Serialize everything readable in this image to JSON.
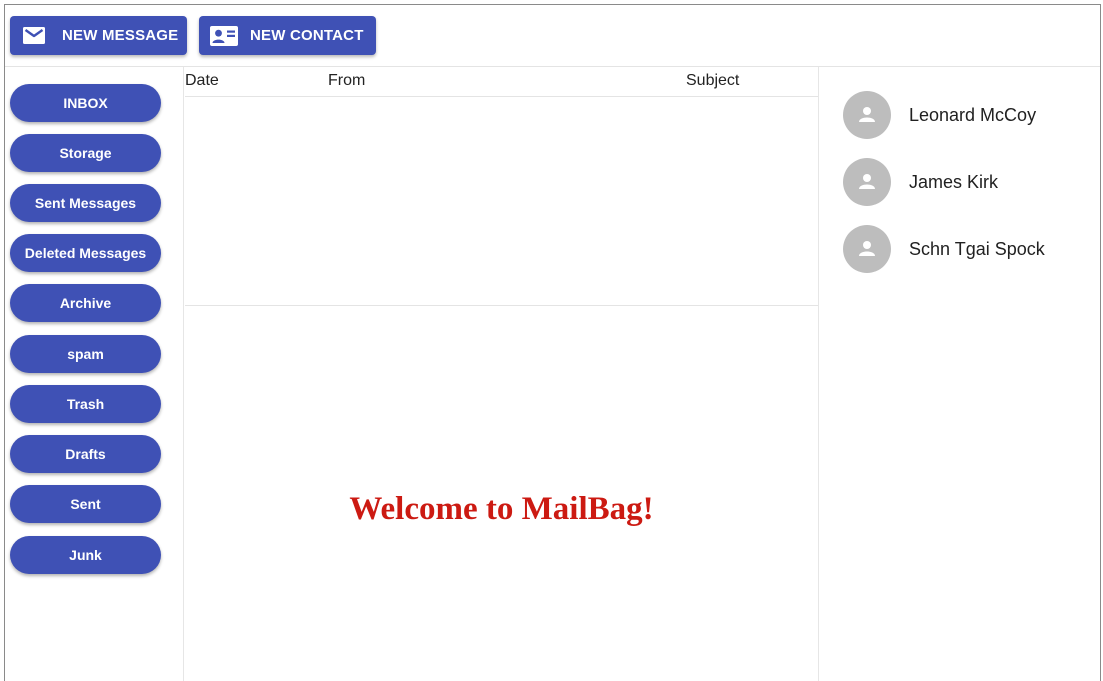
{
  "toolbar": {
    "new_message_label": "NEW MESSAGE",
    "new_contact_label": "NEW CONTACT"
  },
  "folders": [
    {
      "label": "INBOX"
    },
    {
      "label": "Storage"
    },
    {
      "label": "Sent Messages"
    },
    {
      "label": "Deleted Messages"
    },
    {
      "label": "Archive"
    },
    {
      "label": "spam"
    },
    {
      "label": "Trash"
    },
    {
      "label": "Drafts"
    },
    {
      "label": "Sent"
    },
    {
      "label": "Junk"
    }
  ],
  "message_list": {
    "columns": [
      "Date",
      "From",
      "Subject"
    ],
    "rows": []
  },
  "message_view": {
    "welcome_text": "Welcome to MailBag!"
  },
  "contacts": [
    {
      "name": "Leonard McCoy",
      "icon": "person-icon"
    },
    {
      "name": "James Kirk",
      "icon": "person-icon"
    },
    {
      "name": "Schn Tgai Spock",
      "icon": "person-icon"
    }
  ],
  "colors": {
    "primary": "#3f51b5",
    "welcome": "#cc1a12",
    "avatar": "#bdbdbd"
  }
}
